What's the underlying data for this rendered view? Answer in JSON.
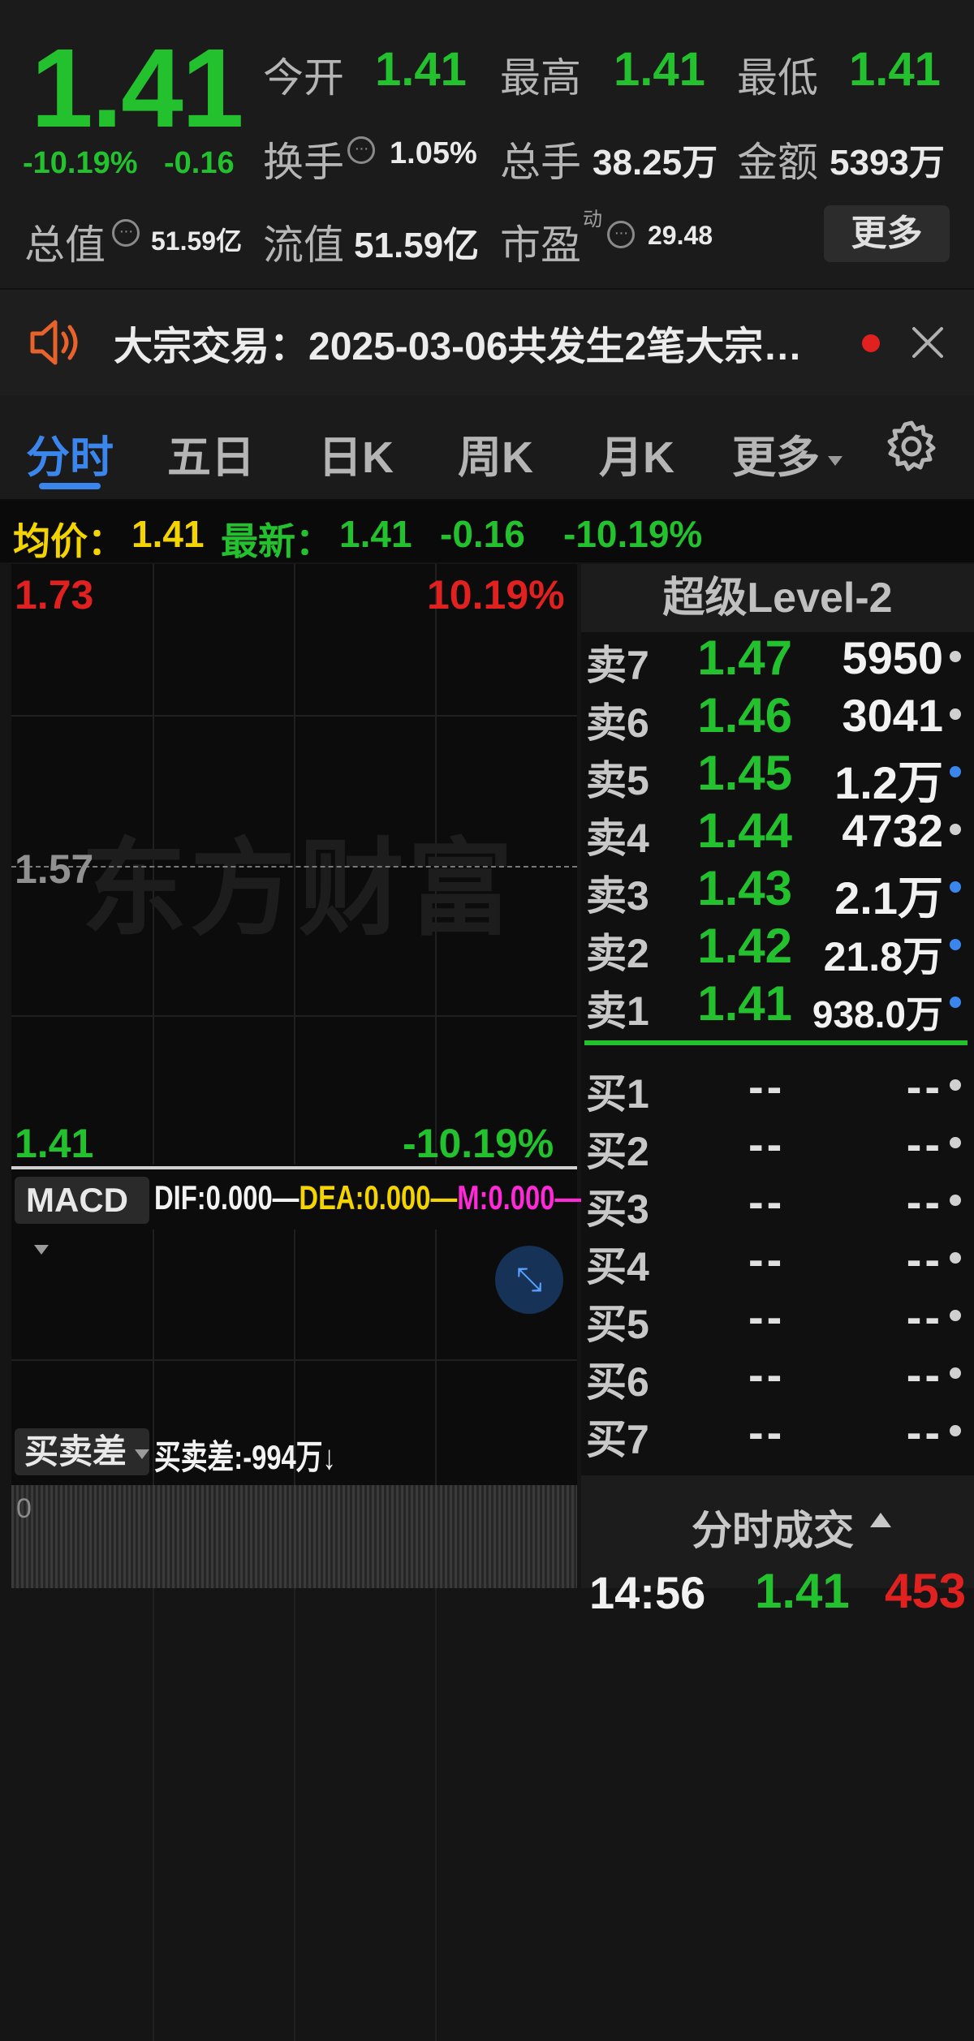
{
  "quote": {
    "price": "1.41",
    "change_pct": "-10.19%",
    "change": "-0.16",
    "open_label": "今开",
    "open": "1.41",
    "high_label": "最高",
    "high": "1.41",
    "low_label": "最低",
    "low": "1.41",
    "turnover_label": "换手",
    "turnover": "1.05%",
    "volume_label": "总手",
    "volume": "38.25万",
    "amount_label": "金额",
    "amount": "5393万",
    "mktcap_label": "总值",
    "mktcap": "51.59亿",
    "float_label": "流值",
    "float_cap": "51.59亿",
    "pe_label": "市盈",
    "pe_sup": "动",
    "pe": "29.48",
    "more": "更多"
  },
  "news": {
    "text": "大宗交易：2025-03-06共发生2笔大宗…"
  },
  "tabs": [
    {
      "label": "分时"
    },
    {
      "label": "五日"
    },
    {
      "label": "日K"
    },
    {
      "label": "周K"
    },
    {
      "label": "月K"
    },
    {
      "label": "更多"
    }
  ],
  "avgbar": {
    "avg_label": "均价：",
    "avg": "1.41",
    "last_label": "最新：",
    "last": "1.41",
    "chg": "-0.16",
    "pct": "-10.19%"
  },
  "chart": {
    "top_price": "1.73",
    "top_pct": "10.19%",
    "mid_price": "1.57",
    "bottom_price": "1.41",
    "bottom_pct": "-10.19%",
    "watermark": "东方财富",
    "macd_selector": "MACD",
    "dif": "DIF:0.000",
    "dea": "DEA:0.000",
    "m": "M:0.000",
    "bs_selector": "买卖差",
    "bs_value": "买卖差:-994万↓",
    "vol_zero": "0"
  },
  "book": {
    "title": "超级Level-2",
    "asks": [
      {
        "label": "卖7",
        "price": "1.47",
        "vol": "5950",
        "dot": "gray"
      },
      {
        "label": "卖6",
        "price": "1.46",
        "vol": "3041",
        "dot": "gray"
      },
      {
        "label": "卖5",
        "price": "1.45",
        "vol": "1.2万",
        "dot": "blue"
      },
      {
        "label": "卖4",
        "price": "1.44",
        "vol": "4732",
        "dot": "gray"
      },
      {
        "label": "卖3",
        "price": "1.43",
        "vol": "2.1万",
        "dot": "blue"
      },
      {
        "label": "卖2",
        "price": "1.42",
        "vol": "21.8万",
        "dot": "blue"
      },
      {
        "label": "卖1",
        "price": "1.41",
        "vol": "938.0万",
        "dot": "blue"
      }
    ],
    "bids": [
      {
        "label": "买1",
        "price": "--",
        "vol": "--"
      },
      {
        "label": "买2",
        "price": "--",
        "vol": "--"
      },
      {
        "label": "买3",
        "price": "--",
        "vol": "--"
      },
      {
        "label": "买4",
        "price": "--",
        "vol": "--"
      },
      {
        "label": "买5",
        "price": "--",
        "vol": "--"
      },
      {
        "label": "买6",
        "price": "--",
        "vol": "--"
      },
      {
        "label": "买7",
        "price": "--",
        "vol": "--"
      }
    ],
    "ticks_title": "分时成交",
    "tick": {
      "time": "14:56",
      "price": "1.41",
      "vol": "453"
    }
  },
  "colors": {
    "up": "#e0211f",
    "down": "#24c12f",
    "accent": "#3b86ec"
  }
}
